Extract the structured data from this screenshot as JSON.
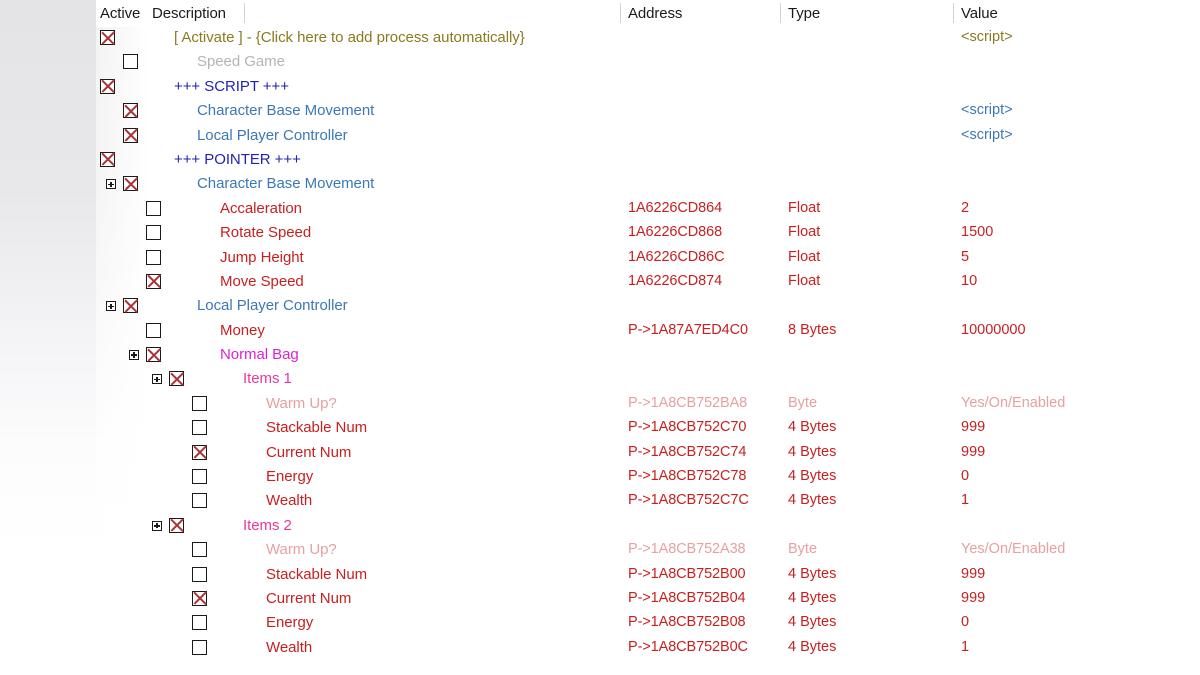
{
  "window": {
    "title": "Cheat Table",
    "background": "#ffffff"
  },
  "colors": {
    "olive": "#8a7a20",
    "gray": "#b5b5b5",
    "navy": "#2222bb",
    "blue": "#3c78b4",
    "red": "#c82020",
    "pink": "#e8389c",
    "magenta": "#dd22cc",
    "faded_red": "#e8a0a0",
    "header_text": "#1b1b1b",
    "separator": "#d3d3d3"
  },
  "header": {
    "active": "Active",
    "description": "Description",
    "address": "Address",
    "type": "Type",
    "value": "Value"
  },
  "rows": [
    {
      "indent": 0,
      "checked": true,
      "expandable": false,
      "description": "[ Activate ] - {Click here to add process automatically}",
      "address": "",
      "type": "",
      "value": "<script>",
      "color": "olive"
    },
    {
      "indent": 1,
      "checked": false,
      "expandable": false,
      "description": "Speed Game",
      "address": "",
      "type": "",
      "value": "",
      "color": "gray"
    },
    {
      "indent": 0,
      "checked": true,
      "expandable": false,
      "description": "+++ SCRIPT +++",
      "address": "",
      "type": "",
      "value": "",
      "color": "navy"
    },
    {
      "indent": 1,
      "checked": true,
      "expandable": false,
      "description": "Character Base Movement",
      "address": "",
      "type": "",
      "value": "<script>",
      "color": "blue"
    },
    {
      "indent": 1,
      "checked": true,
      "expandable": false,
      "description": "Local Player Controller",
      "address": "",
      "type": "",
      "value": "<script>",
      "color": "blue"
    },
    {
      "indent": 0,
      "checked": true,
      "expandable": false,
      "description": "+++ POINTER +++",
      "address": "",
      "type": "",
      "value": "",
      "color": "navy"
    },
    {
      "indent": 1,
      "checked": true,
      "expandable": true,
      "description": "Character Base Movement",
      "address": "",
      "type": "",
      "value": "",
      "color": "blue"
    },
    {
      "indent": 2,
      "checked": false,
      "expandable": false,
      "description": "Accaleration",
      "address": "1A6226CD864",
      "type": "Float",
      "value": "2",
      "color": "red"
    },
    {
      "indent": 2,
      "checked": false,
      "expandable": false,
      "description": "Rotate Speed",
      "address": "1A6226CD868",
      "type": "Float",
      "value": "1500",
      "color": "red"
    },
    {
      "indent": 2,
      "checked": false,
      "expandable": false,
      "description": "Jump Height",
      "address": "1A6226CD86C",
      "type": "Float",
      "value": "5",
      "color": "red"
    },
    {
      "indent": 2,
      "checked": true,
      "expandable": false,
      "description": "Move Speed",
      "address": "1A6226CD874",
      "type": "Float",
      "value": "10",
      "color": "red"
    },
    {
      "indent": 1,
      "checked": true,
      "expandable": true,
      "description": "Local Player Controller",
      "address": "",
      "type": "",
      "value": "",
      "color": "blue"
    },
    {
      "indent": 2,
      "checked": false,
      "expandable": false,
      "description": "Money",
      "address": "P->1A87A7ED4C0",
      "type": "8 Bytes",
      "value": "10000000",
      "color": "red"
    },
    {
      "indent": 2,
      "checked": true,
      "expandable": true,
      "description": "Normal Bag",
      "address": "",
      "type": "",
      "value": "",
      "color": "magenta"
    },
    {
      "indent": 3,
      "checked": true,
      "expandable": true,
      "description": "Items 1",
      "address": "",
      "type": "",
      "value": "",
      "color": "pink"
    },
    {
      "indent": 4,
      "checked": false,
      "expandable": false,
      "description": "Warm Up?",
      "address": "P->1A8CB752BA8",
      "type": "Byte",
      "value": "Yes/On/Enabled",
      "color": "faded"
    },
    {
      "indent": 4,
      "checked": false,
      "expandable": false,
      "description": "Stackable Num",
      "address": "P->1A8CB752C70",
      "type": "4 Bytes",
      "value": "999",
      "color": "red"
    },
    {
      "indent": 4,
      "checked": true,
      "expandable": false,
      "description": "Current Num",
      "address": "P->1A8CB752C74",
      "type": "4 Bytes",
      "value": "999",
      "color": "red"
    },
    {
      "indent": 4,
      "checked": false,
      "expandable": false,
      "description": "Energy",
      "address": "P->1A8CB752C78",
      "type": "4 Bytes",
      "value": "0",
      "color": "red"
    },
    {
      "indent": 4,
      "checked": false,
      "expandable": false,
      "description": "Wealth",
      "address": "P->1A8CB752C7C",
      "type": "4 Bytes",
      "value": "1",
      "color": "red"
    },
    {
      "indent": 3,
      "checked": true,
      "expandable": true,
      "description": "Items 2",
      "address": "",
      "type": "",
      "value": "",
      "color": "pink"
    },
    {
      "indent": 4,
      "checked": false,
      "expandable": false,
      "description": "Warm Up?",
      "address": "P->1A8CB752A38",
      "type": "Byte",
      "value": "Yes/On/Enabled",
      "color": "faded"
    },
    {
      "indent": 4,
      "checked": false,
      "expandable": false,
      "description": "Stackable Num",
      "address": "P->1A8CB752B00",
      "type": "4 Bytes",
      "value": "999",
      "color": "red"
    },
    {
      "indent": 4,
      "checked": true,
      "expandable": false,
      "description": "Current Num",
      "address": "P->1A8CB752B04",
      "type": "4 Bytes",
      "value": "999",
      "color": "red"
    },
    {
      "indent": 4,
      "checked": false,
      "expandable": false,
      "description": "Energy",
      "address": "P->1A8CB752B08",
      "type": "4 Bytes",
      "value": "0",
      "color": "red"
    },
    {
      "indent": 4,
      "checked": false,
      "expandable": false,
      "description": "Wealth",
      "address": "P->1A8CB752B0C",
      "type": "4 Bytes",
      "value": "1",
      "color": "red"
    }
  ]
}
